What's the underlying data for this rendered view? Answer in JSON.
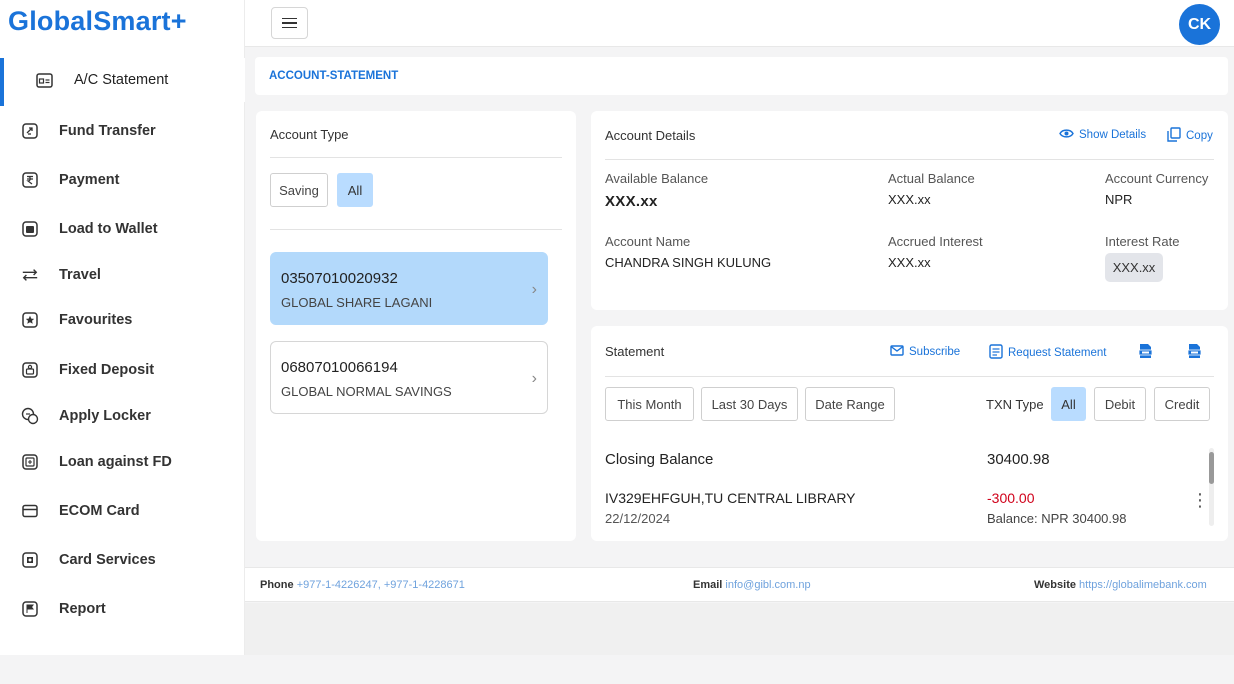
{
  "app": {
    "logo": "GlobalSmart+"
  },
  "topbar": {
    "avatar_initials": "CK"
  },
  "sidebar": {
    "items": [
      {
        "label": "A/C Statement",
        "icon": "statement-icon",
        "active": true
      },
      {
        "label": "Fund Transfer",
        "icon": "transfer-icon"
      },
      {
        "label": "Payment",
        "icon": "rupee-icon"
      },
      {
        "label": "Load to Wallet",
        "icon": "wallet-icon"
      },
      {
        "label": "Travel",
        "icon": "arrows-icon"
      },
      {
        "label": "Favourites",
        "icon": "star-icon"
      },
      {
        "label": "Fixed Deposit",
        "icon": "deposit-icon"
      },
      {
        "label": "Apply Locker",
        "icon": "locker-icon"
      },
      {
        "label": "Loan against FD",
        "icon": "loan-icon"
      },
      {
        "label": "ECOM Card",
        "icon": "card-icon"
      },
      {
        "label": "Card Services",
        "icon": "card-services-icon"
      },
      {
        "label": "Report",
        "icon": "flag-icon"
      }
    ]
  },
  "breadcrumb": {
    "title": "ACCOUNT-STATEMENT"
  },
  "account_type": {
    "title": "Account Type",
    "filters": [
      {
        "label": "Saving",
        "selected": false
      },
      {
        "label": "All",
        "selected": true
      }
    ],
    "accounts": [
      {
        "number": "03507010020932",
        "name": "GLOBAL SHARE LAGANI",
        "selected": true
      },
      {
        "number": "06807010066194",
        "name": "GLOBAL NORMAL SAVINGS",
        "selected": false
      }
    ]
  },
  "account_details": {
    "title": "Account Details",
    "show_details": "Show Details",
    "copy": "Copy",
    "available_balance_label": "Available Balance",
    "available_balance": "XXX.xx",
    "actual_balance_label": "Actual Balance",
    "actual_balance": "XXX.xx",
    "currency_label": "Account Currency",
    "currency": "NPR",
    "account_name_label": "Account Name",
    "account_name": "CHANDRA SINGH KULUNG",
    "accrued_interest_label": "Accrued Interest",
    "accrued_interest": "XXX.xx",
    "interest_rate_label": "Interest Rate",
    "interest_rate": "XXX.xx"
  },
  "statement": {
    "title": "Statement",
    "subscribe": "Subscribe",
    "request_statement": "Request Statement",
    "periods": [
      "This Month",
      "Last 30 Days",
      "Date Range"
    ],
    "txn_type_label": "TXN Type",
    "txn_types": [
      {
        "label": "All",
        "selected": true
      },
      {
        "label": "Debit"
      },
      {
        "label": "Credit"
      }
    ],
    "closing_balance_label": "Closing Balance",
    "closing_balance": "30400.98",
    "transactions": [
      {
        "description": "IV329EHFGUH,TU CENTRAL LIBRARY",
        "date": "22/12/2024",
        "amount": "-300.00",
        "balance": "Balance: NPR 30400.98"
      }
    ]
  },
  "footer": {
    "phone_label": "Phone",
    "phone": "+977-1-4226247, +977-1-4228671",
    "email_label": "Email",
    "email": "info@gibl.com.np",
    "website_label": "Website",
    "website": "https://globalimebank.com"
  },
  "colors": {
    "accent": "#1a73d9",
    "selected": "#b9dcff",
    "debit": "#d0021b"
  }
}
